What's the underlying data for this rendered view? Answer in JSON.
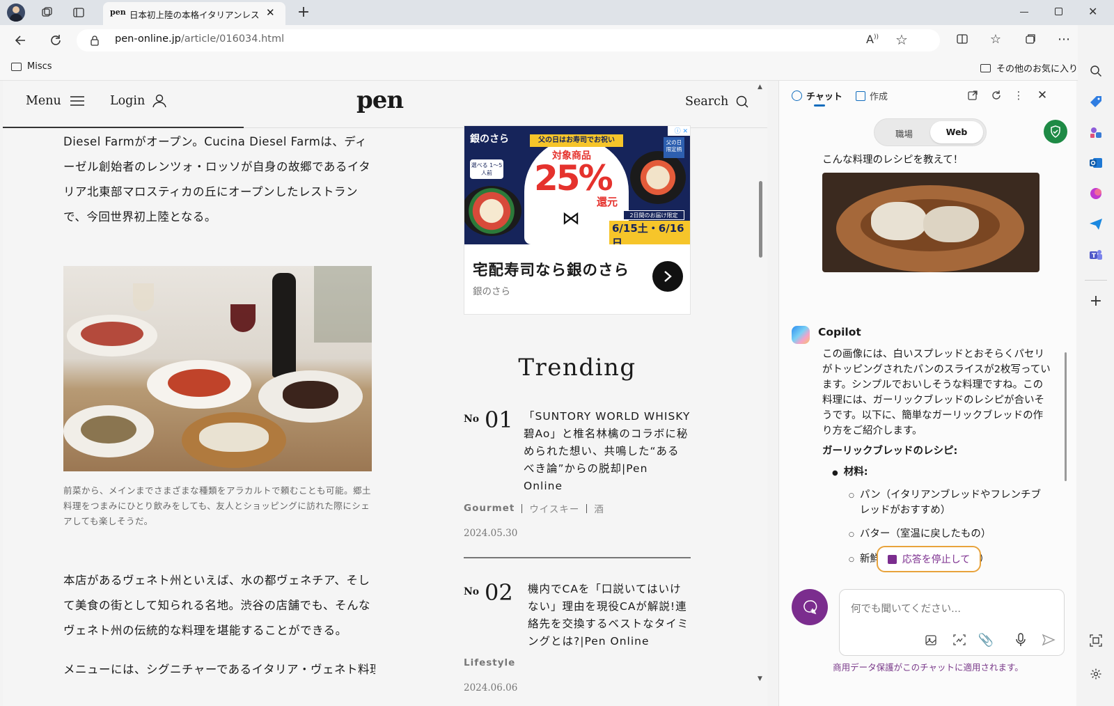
{
  "browser": {
    "tab_title": "日本初上陸の本格イタリアンレストラ",
    "tab_favicon": "pen",
    "url_domain": "pen-online.jp",
    "url_path": "/article/016034.html",
    "favorites_folder": "Miscs",
    "other_favorites": "その他のお気に入り"
  },
  "site": {
    "menu_label": "Menu",
    "login_label": "Login",
    "logo": "pen",
    "search_label": "Search"
  },
  "article": {
    "para1": "Diesel Farmがオープン。Cucina Diesel Farmは、ディーゼル創始者のレンツォ・ロッソが自身の故郷であるイタリア北東部マロスティカの丘にオープンしたレストランで、今回世界初上陸となる。",
    "caption": "前菜から、メインまでさまざまな種類をアラカルトで頼むことも可能。郷土料理をつまみにひとり飲みをしても、友人とショッピングに訪れた際にシェアしても楽しそうだ。",
    "para2": "本店があるヴェネト州といえば、水の都ヴェネチア、そして美食の街として知られる名地。渋谷の店舗でも、そんなヴェネト州の伝統的な料理を堪能することができる。",
    "para3": "メニューには、シグニチャーであるイタリア・ヴェネト料理の名"
  },
  "ad": {
    "brand": "銀のさら",
    "banner_top": "父の日はお寿司でお祝い",
    "banner_target": "対象商品",
    "banner_percent": "25%",
    "banner_return": "還元",
    "banner_choose": "選べる 1〜5人前",
    "banner_dates": "6/15土・6/16日",
    "banner_limit": "2日間のお届け限定",
    "banner_side": "父の日 限定柄",
    "headline": "宅配寿司なら銀のさら",
    "advertiser": "銀のさら"
  },
  "trending": {
    "heading": "Trending",
    "items": [
      {
        "no": "No",
        "num": "01",
        "title": "「SUNTORY WORLD WHISKY 碧Ao」と椎名林檎のコラボに秘められた想い、共鳴した“あるべき論”からの脱却|Pen Online",
        "category": "Gourmet",
        "tags": [
          "ウイスキー",
          "酒"
        ],
        "date": "2024.05.30"
      },
      {
        "no": "No",
        "num": "02",
        "title": "機内でCAを「口説いてはいけない」理由を現役CAが解説!連絡先を交換するベストなタイミングとは?|Pen Online",
        "category": "Lifestyle",
        "date": "2024.06.06"
      }
    ]
  },
  "copilot": {
    "tab_chat": "チャット",
    "tab_compose": "作成",
    "toggle_work": "職場",
    "toggle_web": "Web",
    "user_message": "こんな料理のレシピを教えて！",
    "bot_name": "Copilot",
    "bot_intro": "この画像には、白いスプレッドとおそらくパセリがトッピングされたパンのスライスが2枚写っています。シンプルでおいしそうな料理ですね。この料理には、ガーリックブレッドのレシピが合いそうです。以下に、簡単なガーリックブレッドの作り方をご紹介します。",
    "recipe_title": "ガーリックブレッドのレシピ",
    "ingredients_label": "材料",
    "ingredient1": "パン（イタリアンブレッドやフレンチブレッドがおすすめ）",
    "ingredient2": "バター（室温に戻したもの）",
    "ingredient3_start": "新鮮",
    "ingredient3_end": "り）",
    "stop_label": "応答を停止して",
    "input_placeholder": "何でも聞いてください...",
    "protection_note": "商用データ保護がこのチャットに適用されます。"
  },
  "colors": {
    "accent": "#0f6cbd",
    "copilot_purple": "#7b2d8e",
    "stop_border": "#e8a33c",
    "protection_text": "#7a3a8a"
  }
}
